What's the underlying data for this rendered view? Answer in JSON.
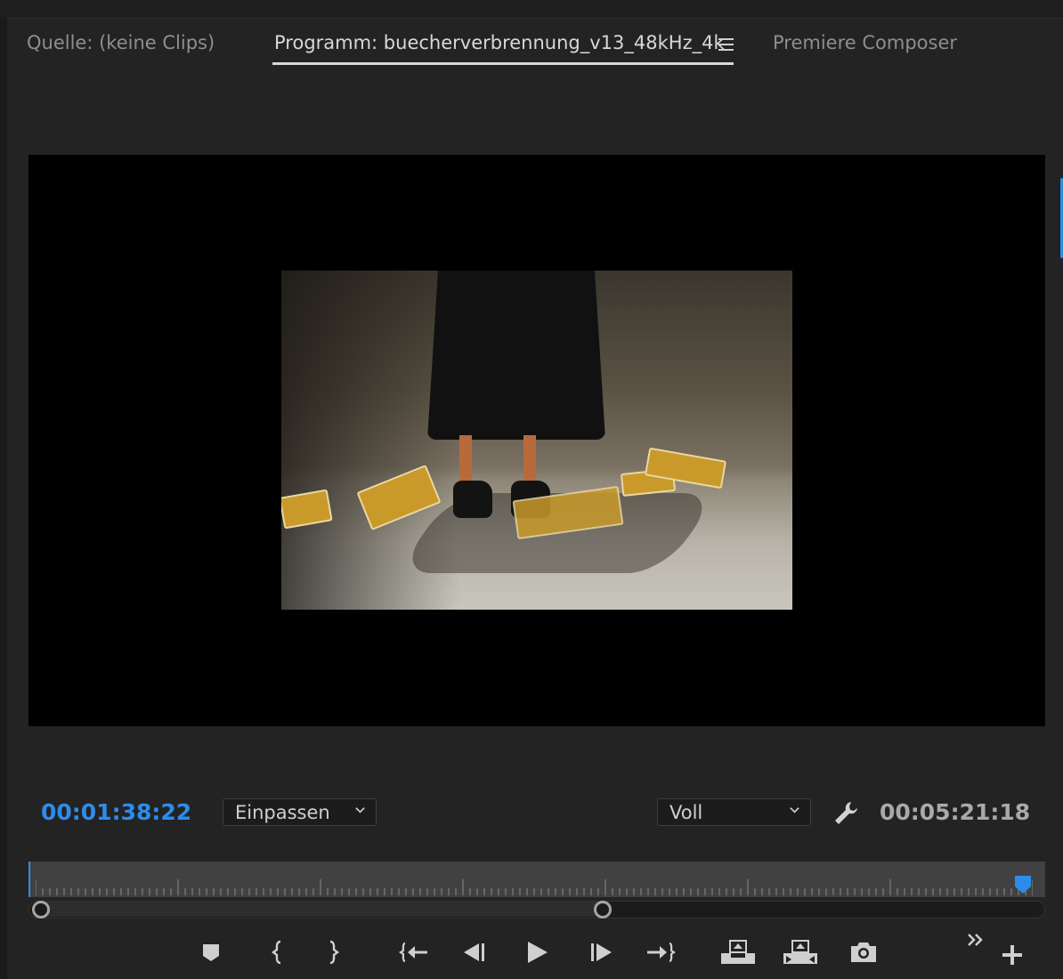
{
  "tabs": [
    {
      "label": "Quelle: (keine Clips)",
      "active": false
    },
    {
      "label": "Programm: buecherverbrennung_v13_48kHz_4k",
      "active": true
    },
    {
      "label": "Premiere Composer",
      "active": false
    }
  ],
  "tab_menu_icon": "hamburger-menu-icon",
  "monitor": {
    "current_timecode": "00:01:38:22",
    "duration_timecode": "00:05:21:18",
    "zoom_dropdown": "Einpassen",
    "quality_dropdown": "Voll",
    "settings_icon": "wrench-icon"
  },
  "colors": {
    "accent": "#2d8ceb",
    "panel_bg": "#232323",
    "viewer_bg": "#000000"
  },
  "transport": [
    {
      "name": "add-marker-button",
      "icon": "marker-icon"
    },
    {
      "name": "mark-in-button",
      "icon": "mark-in-icon"
    },
    {
      "name": "mark-out-button",
      "icon": "mark-out-icon"
    },
    {
      "name": "go-to-in-button",
      "icon": "go-to-in-icon"
    },
    {
      "name": "step-back-button",
      "icon": "step-back-icon"
    },
    {
      "name": "play-button",
      "icon": "play-icon"
    },
    {
      "name": "step-forward-button",
      "icon": "step-forward-icon"
    },
    {
      "name": "go-to-out-button",
      "icon": "go-to-out-icon"
    },
    {
      "name": "lift-button",
      "icon": "lift-icon"
    },
    {
      "name": "extract-button",
      "icon": "extract-icon"
    },
    {
      "name": "export-frame-button",
      "icon": "camera-icon"
    },
    {
      "name": "more-controls-button",
      "icon": "double-chevron-right-icon"
    },
    {
      "name": "button-editor-button",
      "icon": "plus-icon"
    }
  ]
}
